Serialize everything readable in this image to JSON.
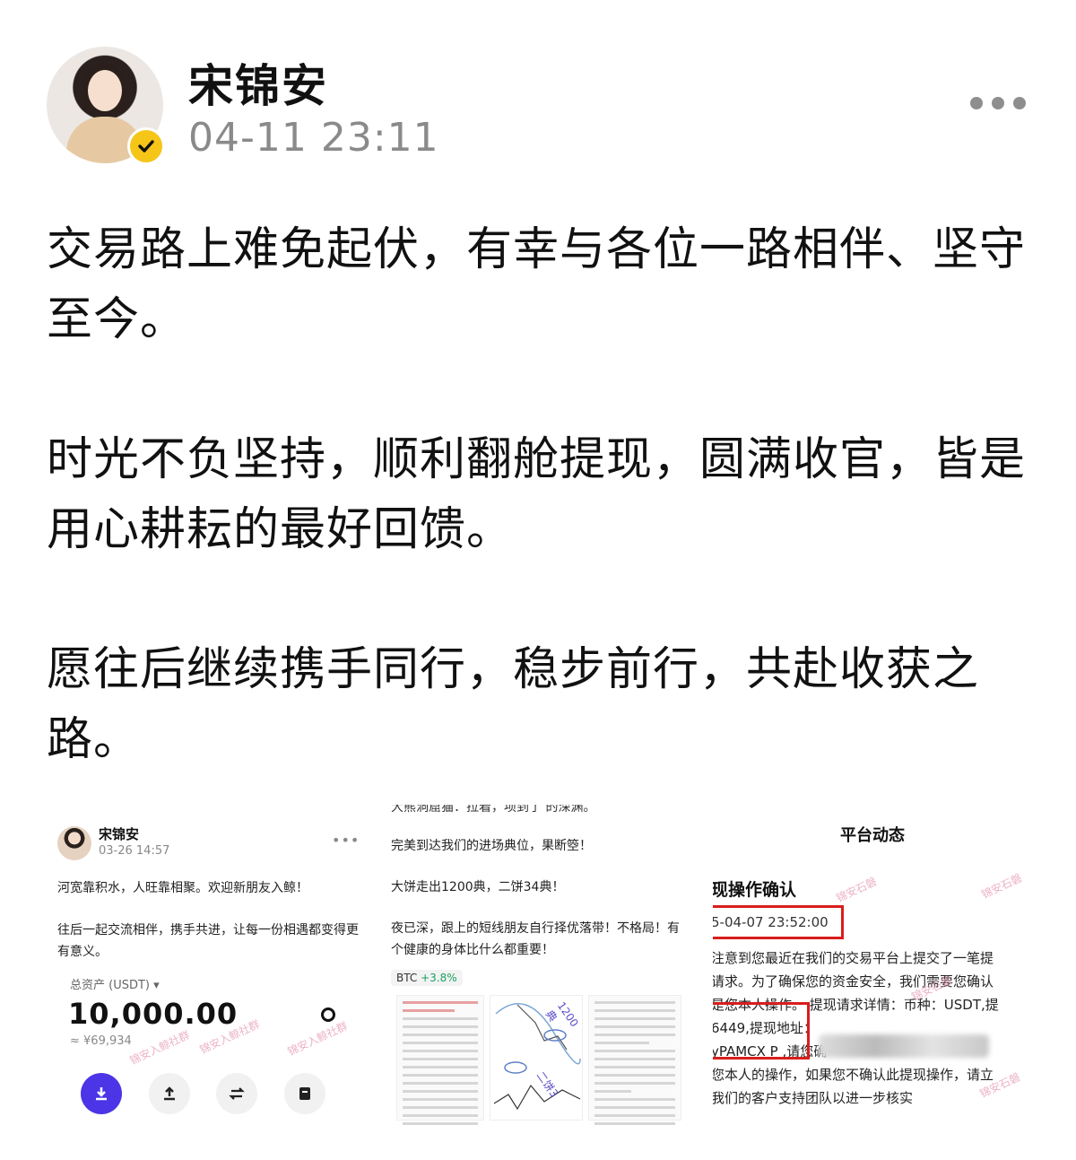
{
  "author": {
    "name": "宋锦安",
    "time": "04-11 23:11",
    "verified": true
  },
  "post": {
    "paragraphs": [
      "交易路上难免起伏，有幸与各位一路相伴、坚守至今。",
      "时光不负坚持，顺利翻舱提现，圆满收官，皆是用心耕耘的最好回馈。",
      "愿往后继续携手同行，稳步前行，共赴收获之路。"
    ]
  },
  "images": {
    "first": {
      "name": "宋锦安",
      "time": "03-26 14:57",
      "line1": "河宽靠积水，人旺靠相聚。欢迎新朋友入鲸！",
      "line2": "往后一起交流相伴，携手共进，让每一份相遇都变得更有意义。",
      "asset_label": "总资产 (USDT) ▾",
      "asset_value": "10,000.00",
      "asset_equiv": "≈ ¥69,934",
      "watermark": "锦安入鲸社群"
    },
    "second": {
      "cut_line": "大熊洞窟猫：拉着，项到了 的深渊。",
      "p1": "完美到达我们的进场典位，果断箜！",
      "p2": "大饼走出1200典，二饼34典！",
      "p3": "夜已深，跟上的短线朋友自行择优落带！不格局！有个健康的身体比什么都重要！",
      "chip_coin": "BTC",
      "chip_change": "+3.8%",
      "label_a": "1200典",
      "label_b": "二饼3"
    },
    "third": {
      "header": "平台动态",
      "subtitle": "现操作确认",
      "datetime": "5-04-07 23:52:00",
      "lines": [
        "注意到您最近在我们的交易平台上提交了一笔提",
        "请求。为了确保您的资金安全，我们需要您确认",
        "是您本人操作。 提现请求详情：币种：USDT,提",
        "6449,提现地址：",
        "yPAMCX               P           ,请您确",
        "您本人的操作，如果您不确认此提现操作，请立",
        "我们的客户支持团队以进一步核实"
      ],
      "watermark": "锦安石磐"
    }
  },
  "icons": {
    "more": "more-horizontal-icon",
    "verified": "verified-badge-icon",
    "eye": "eye-icon"
  },
  "colors": {
    "accent_button": "#4b35e6",
    "verify_badge": "#f5c518",
    "highlight_box": "#d91d1d"
  }
}
